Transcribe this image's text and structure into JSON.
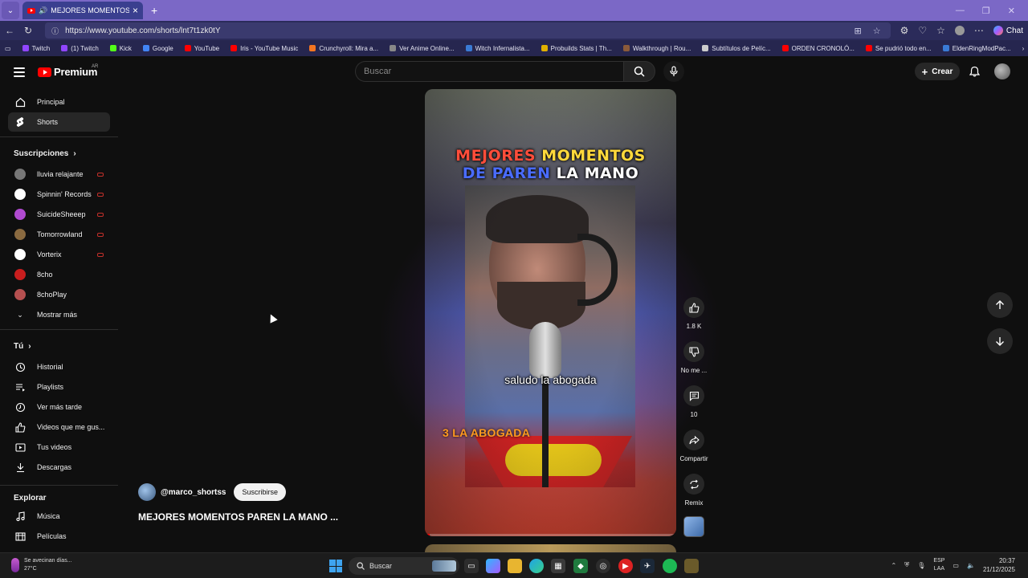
{
  "browser": {
    "tab_title": "MEJORES MOMENTOS PAREN",
    "url": "https://www.youtube.com/shorts/lnt7t1zk0tY",
    "chat_label": "Chat",
    "bookmarks": [
      {
        "label": "Twitch",
        "color": "#9146ff"
      },
      {
        "label": "(1) Twitch",
        "color": "#9146ff"
      },
      {
        "label": "Kick",
        "color": "#53fc18"
      },
      {
        "label": "Google",
        "color": "#4285f4"
      },
      {
        "label": "YouTube",
        "color": "#ff0000"
      },
      {
        "label": "Iris - YouTube Music",
        "color": "#ff0000"
      },
      {
        "label": "Crunchyroll: Mira a...",
        "color": "#f47521"
      },
      {
        "label": "Ver Anime Online...",
        "color": "#888888"
      },
      {
        "label": "Witch Infernalista...",
        "color": "#3a7bd5"
      },
      {
        "label": "Probuilds Stats | Th...",
        "color": "#e0b000"
      },
      {
        "label": "Walkthrough | Rou...",
        "color": "#8a5a3a"
      },
      {
        "label": "Subtítulos de Pelíc...",
        "color": "#cccccc"
      },
      {
        "label": "ORDEN CRONOLÓ...",
        "color": "#ff0000"
      },
      {
        "label": "Se pudrió todo en...",
        "color": "#ff0000"
      },
      {
        "label": "EldenRingModPac...",
        "color": "#3a7bd5"
      }
    ]
  },
  "header": {
    "logo_text": "Premium",
    "region": "AR",
    "search_placeholder": "Buscar",
    "create_label": "Crear"
  },
  "sidebar": {
    "main": [
      {
        "label": "Principal",
        "icon": "home-icon"
      },
      {
        "label": "Shorts",
        "icon": "shorts-icon"
      }
    ],
    "subscriptions_heading": "Suscripciones",
    "subscriptions": [
      {
        "label": "lluvia relajante",
        "color": "#777777"
      },
      {
        "label": "Spinnin' Records",
        "color": "#ffffff"
      },
      {
        "label": "SuicideSheeep",
        "color": "#b04ad0"
      },
      {
        "label": "Tomorrowland",
        "color": "#8a6a40"
      },
      {
        "label": "Vorterix",
        "color": "#ffffff"
      },
      {
        "label": "8cho",
        "color": "#c81e1e"
      },
      {
        "label": "8choPlay",
        "color": "#b55050"
      }
    ],
    "show_more": "Mostrar más",
    "you_heading": "Tú",
    "you_items": [
      {
        "label": "Historial"
      },
      {
        "label": "Playlists"
      },
      {
        "label": "Ver más tarde"
      },
      {
        "label": "Videos que me gus..."
      },
      {
        "label": "Tus videos"
      },
      {
        "label": "Descargas"
      }
    ],
    "explore_heading": "Explorar",
    "explore_items": [
      {
        "label": "Música"
      },
      {
        "label": "Películas"
      }
    ]
  },
  "short": {
    "channel": "@marco_shortss",
    "subscribe_label": "Suscribirse",
    "title": "MEJORES MOMENTOS PAREN LA MANO ...",
    "video_title_line1_a": "MEJORES",
    "video_title_line1_b": "MOMENTOS",
    "video_title_line2_a": "DE PAREN",
    "video_title_line2_b": "LA MANO",
    "subtitle": "saludo la abogada",
    "ranking_label": "3 LA ABOGADA",
    "progress": 0.02
  },
  "actions": {
    "likes": "1.8 K",
    "dislike": "No me ...",
    "comments": "10",
    "share": "Compartir",
    "remix": "Remix"
  },
  "taskbar": {
    "weather_line1": "Se avecinan días...",
    "weather_line2": "27°C",
    "search_label": "Buscar",
    "lang_line1": "ESP",
    "lang_line2": "LAA",
    "time": "20:37",
    "date": "21/12/2025"
  }
}
